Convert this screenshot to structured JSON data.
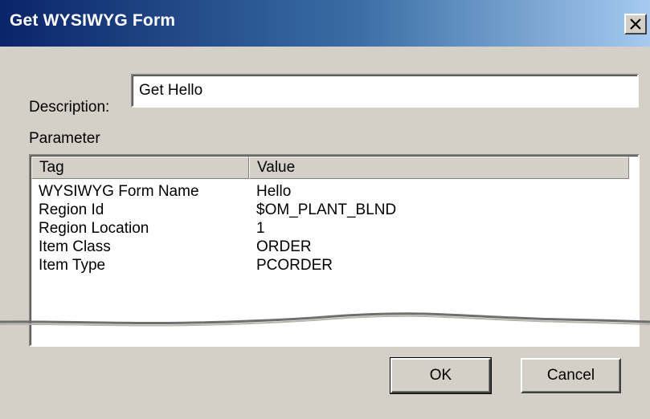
{
  "window": {
    "title": "Get WYSIWYG Form",
    "close_icon": "close-x-icon"
  },
  "form": {
    "description_label": "Description:",
    "description_value": "Get Hello",
    "parameter_label": "Parameter"
  },
  "parameters": {
    "columns": [
      "Tag",
      "Value"
    ],
    "rows": [
      {
        "tag": "WYSIWYG Form Name",
        "value": "Hello"
      },
      {
        "tag": "Region Id",
        "value": "$OM_PLANT_BLND"
      },
      {
        "tag": "Region Location",
        "value": "1"
      },
      {
        "tag": "Item Class",
        "value": "ORDER"
      },
      {
        "tag": "Item Type",
        "value": "PCORDER"
      }
    ]
  },
  "buttons": {
    "ok": "OK",
    "cancel": "Cancel"
  }
}
